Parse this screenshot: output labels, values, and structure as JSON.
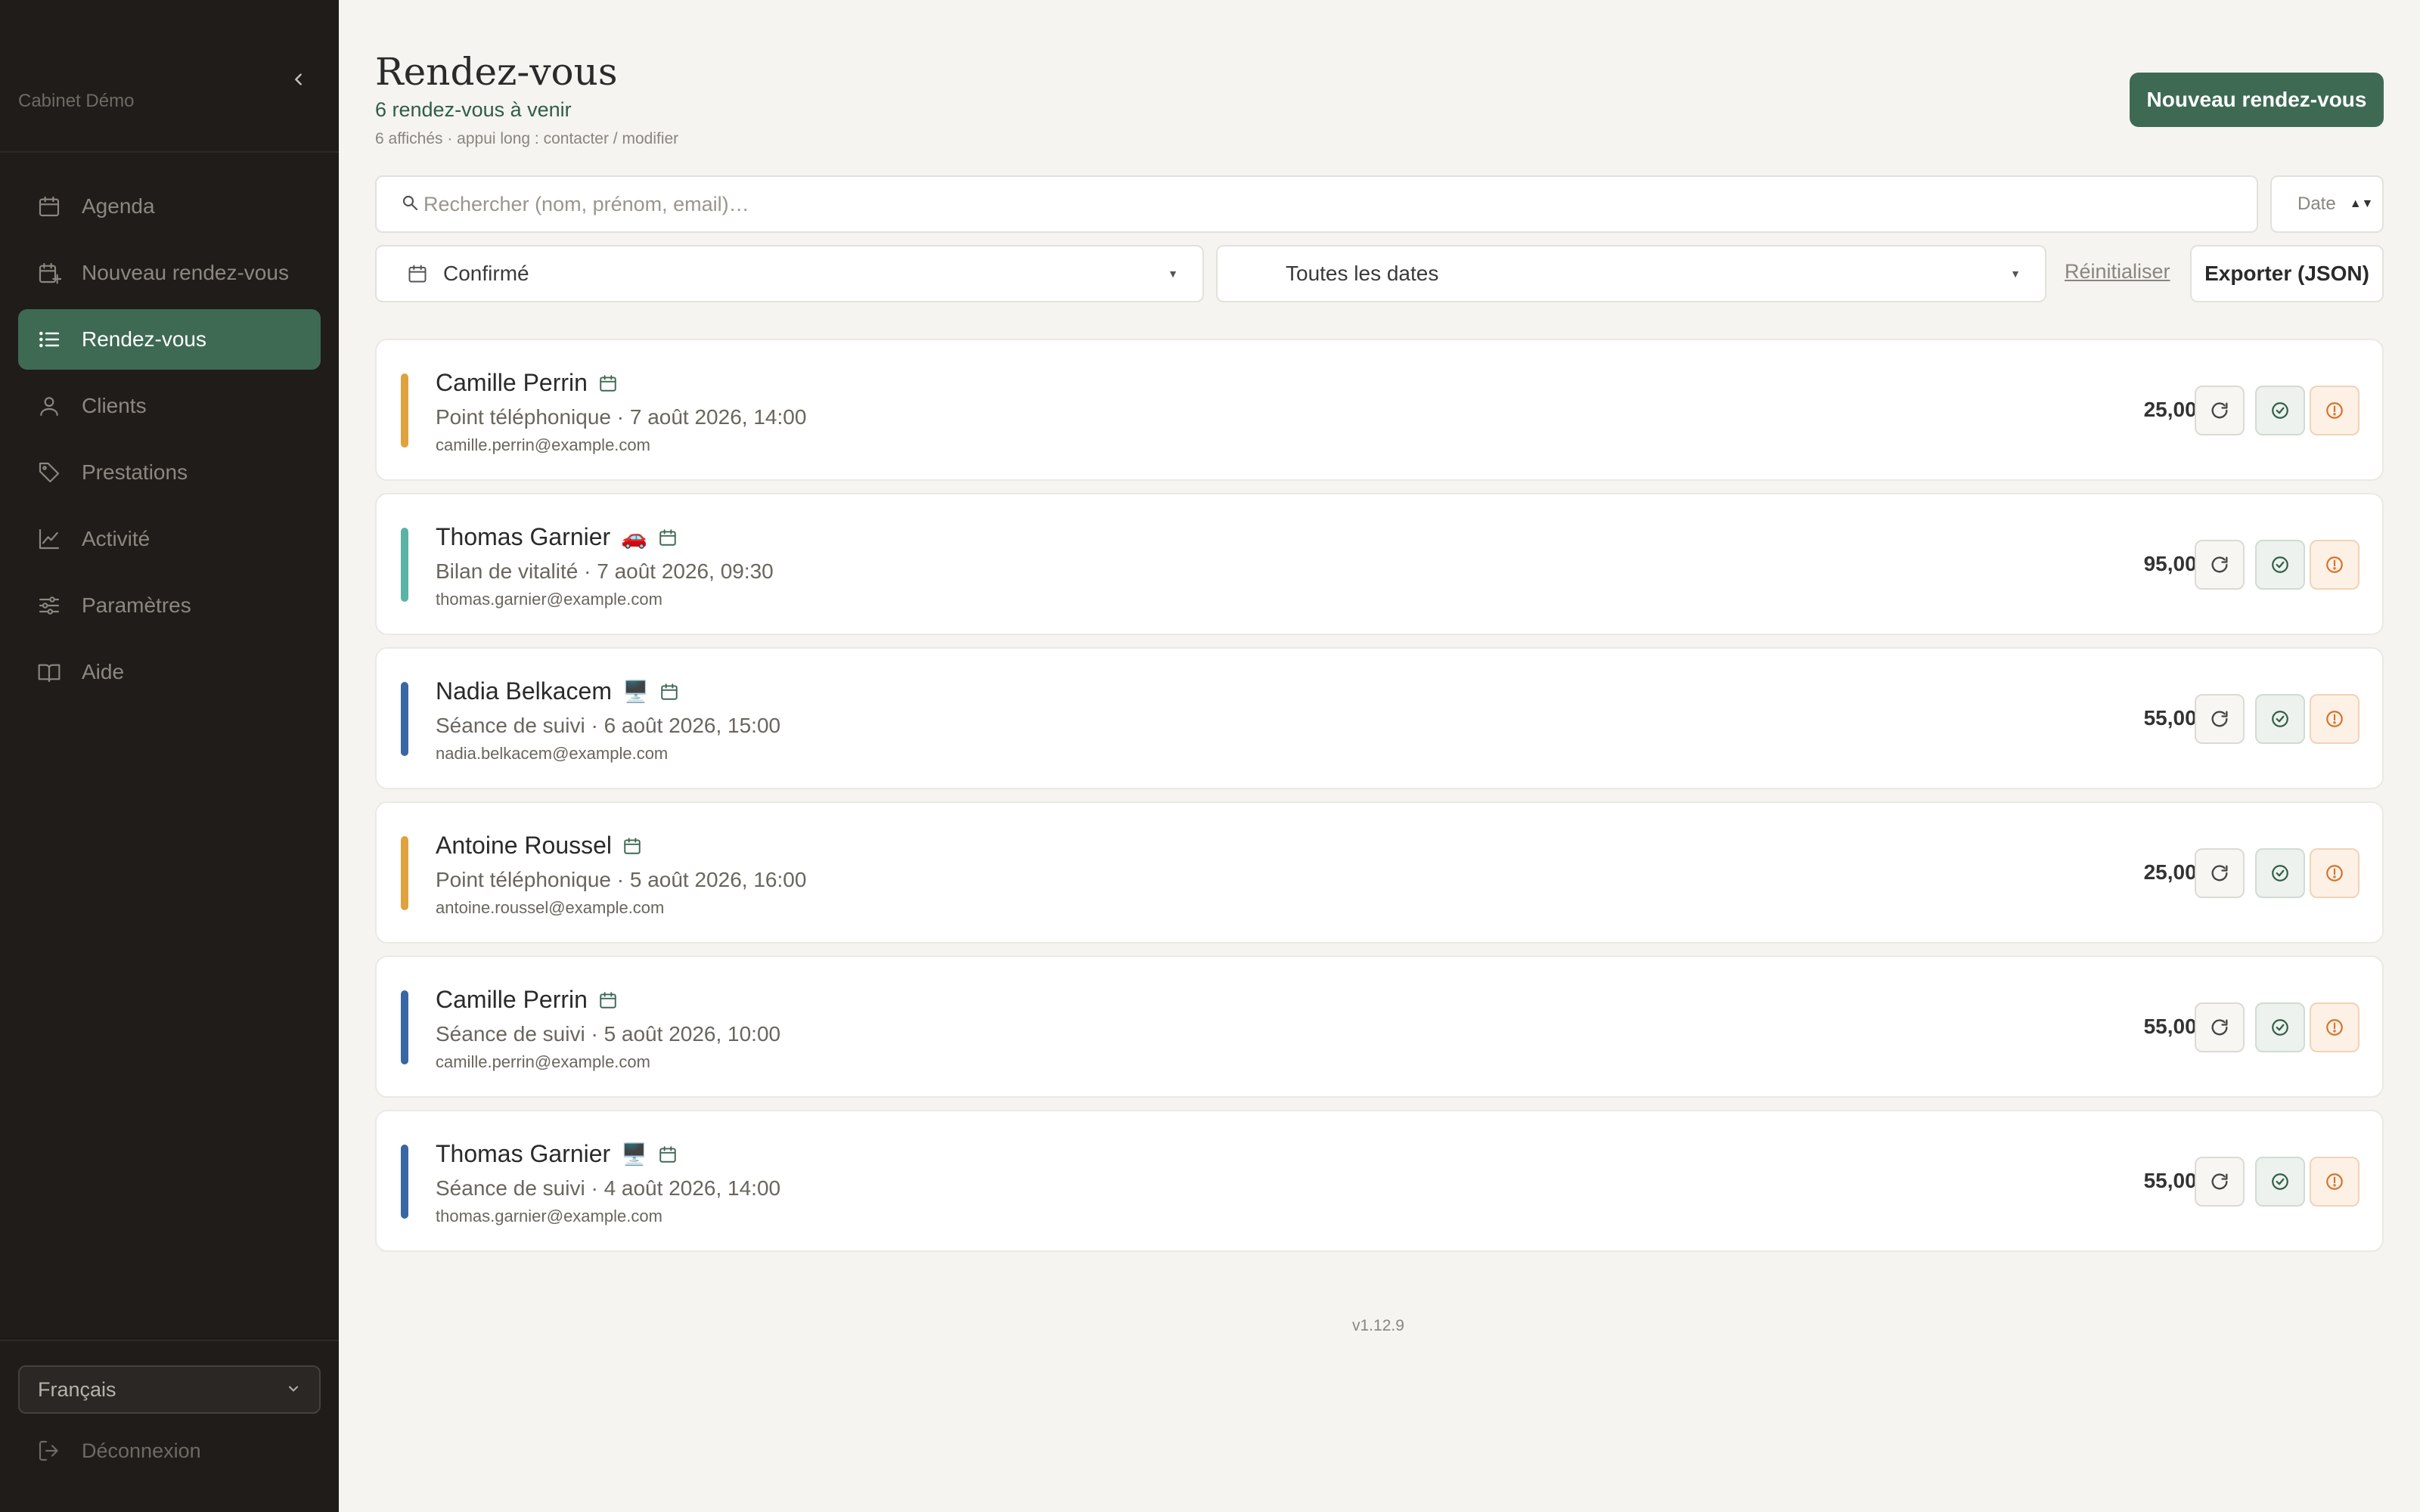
{
  "sidebar": {
    "brand": "Cabinet Démo",
    "items": [
      {
        "label": "Agenda",
        "icon": "calendar-icon"
      },
      {
        "label": "Nouveau rendez-vous",
        "icon": "calendar-plus-icon"
      },
      {
        "label": "Rendez-vous",
        "icon": "list-icon",
        "active": true
      },
      {
        "label": "Clients",
        "icon": "user-icon"
      },
      {
        "label": "Prestations",
        "icon": "tag-icon"
      },
      {
        "label": "Activité",
        "icon": "chart-icon"
      },
      {
        "label": "Paramètres",
        "icon": "sliders-icon"
      },
      {
        "label": "Aide",
        "icon": "book-icon"
      }
    ],
    "language": "Français",
    "logout": "Déconnexion"
  },
  "header": {
    "title": "Rendez-vous",
    "subtitle": "6 rendez-vous à venir",
    "hint": "6 affichés · appui long : contacter / modifier",
    "new_button": "Nouveau rendez-vous"
  },
  "search": {
    "placeholder": "Rechercher (nom, prénom, email)…",
    "value": "",
    "sort": "Date"
  },
  "filters": {
    "status": "Confirmé",
    "dates": "Toutes les dates",
    "reset": "Réinitialiser",
    "export": "Exporter (JSON)"
  },
  "appointments": [
    {
      "name": "Camille Perrin",
      "badge": "",
      "meta": "Point téléphonique · 7 août 2026, 14:00",
      "email": "camille.perrin@example.com",
      "price": "25,00 €",
      "color": "#e0a23c"
    },
    {
      "name": "Thomas Garnier",
      "badge": "🚗",
      "meta": "Bilan de vitalité · 7 août 2026, 09:30",
      "email": "thomas.garnier@example.com",
      "price": "95,00 €",
      "color": "#5bb3a5"
    },
    {
      "name": "Nadia Belkacem",
      "badge": "🖥️",
      "meta": "Séance de suivi · 6 août 2026, 15:00",
      "email": "nadia.belkacem@example.com",
      "price": "55,00 €",
      "color": "#3a66a3"
    },
    {
      "name": "Antoine Roussel",
      "badge": "",
      "meta": "Point téléphonique · 5 août 2026, 16:00",
      "email": "antoine.roussel@example.com",
      "price": "25,00 €",
      "color": "#e0a23c"
    },
    {
      "name": "Camille Perrin",
      "badge": "",
      "meta": "Séance de suivi · 5 août 2026, 10:00",
      "email": "camille.perrin@example.com",
      "price": "55,00 €",
      "color": "#3a66a3"
    },
    {
      "name": "Thomas Garnier",
      "badge": "🖥️",
      "meta": "Séance de suivi · 4 août 2026, 14:00",
      "email": "thomas.garnier@example.com",
      "price": "55,00 €",
      "color": "#3a66a3"
    }
  ],
  "footer": {
    "version": "v1.12.9"
  },
  "colors": {
    "accent": "#3e6a54",
    "sidebar_bg": "#1f1c19",
    "page_bg": "#f5f4f1"
  }
}
